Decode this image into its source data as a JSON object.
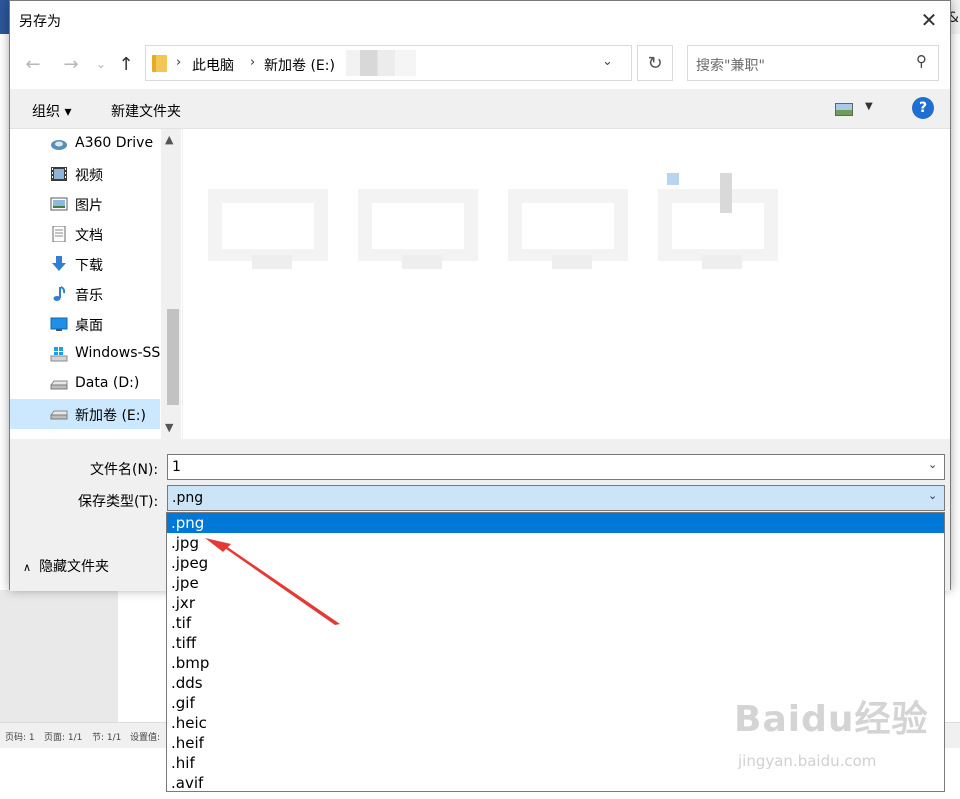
{
  "dialog": {
    "title": "另存为",
    "close_label": "✕"
  },
  "nav": {
    "back_label": "←",
    "forward_label": "→",
    "recent_label": "⌄",
    "up_label": "↑",
    "breadcrumb": [
      "此电脑",
      "新加卷 (E:)"
    ],
    "refresh_label": "↻",
    "search_placeholder": "搜索\"兼职\""
  },
  "toolbar": {
    "organize_label": "组织 ▾",
    "new_folder_label": "新建文件夹",
    "help_label": "?"
  },
  "nav_pane": {
    "items": [
      {
        "label": "A360 Drive",
        "icon": "cloud-icon"
      },
      {
        "label": "视频",
        "icon": "video-icon"
      },
      {
        "label": "图片",
        "icon": "pictures-icon"
      },
      {
        "label": "文档",
        "icon": "documents-icon"
      },
      {
        "label": "下载",
        "icon": "download-icon"
      },
      {
        "label": "音乐",
        "icon": "music-icon"
      },
      {
        "label": "桌面",
        "icon": "desktop-icon"
      },
      {
        "label": "Windows-SS",
        "icon": "windows-drive-icon"
      },
      {
        "label": "Data (D:)",
        "icon": "drive-icon"
      },
      {
        "label": "新加卷 (E:)",
        "icon": "drive-icon"
      }
    ],
    "selected": "新加卷 (E:)"
  },
  "form": {
    "filename_label": "文件名(N):",
    "filename_value": "1",
    "filetype_label": "保存类型(T):",
    "filetype_value": ".png",
    "hide_folders_label": "隐藏文件夹"
  },
  "filetype_options": [
    ".png",
    ".jpg",
    ".jpeg",
    ".jpe",
    ".jxr",
    ".tif",
    ".tiff",
    ".bmp",
    ".dds",
    ".gif",
    ".heic",
    ".heif",
    ".hif",
    ".avif"
  ],
  "selected_filetype": ".png",
  "status_bar": {
    "page_code": "页码: 1",
    "page": "页面: 1/1",
    "section": "节: 1/1",
    "settings": "设置值:"
  },
  "background": {
    "ampersand": "&"
  },
  "watermark": {
    "logo": "Baidu经验",
    "url": "jingyan.baidu.com"
  },
  "colors": {
    "selection_blue": "#0078d7",
    "selected_field": "#cce4f7",
    "nav_selected": "#cce8ff",
    "arrow_red": "#e53935",
    "help_blue": "#1f6fd0"
  }
}
